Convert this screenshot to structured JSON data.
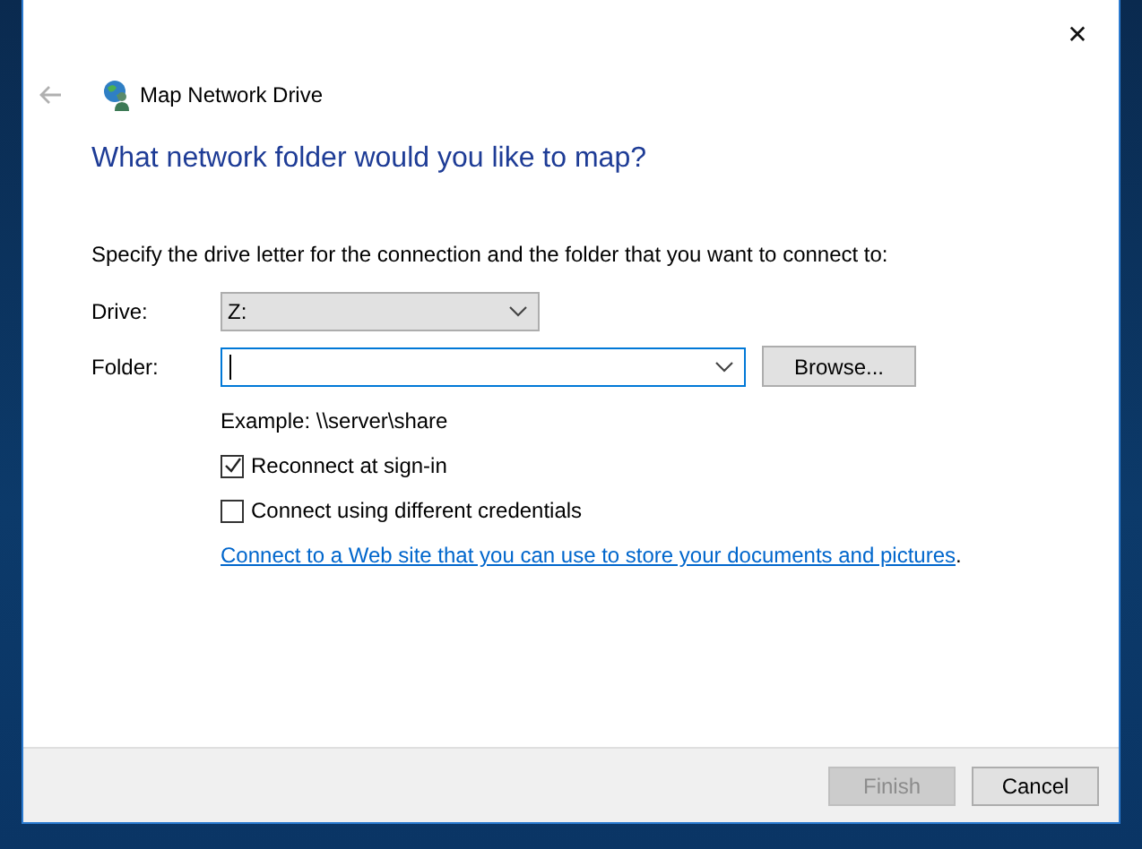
{
  "window": {
    "title": "Map Network Drive",
    "close": "✕"
  },
  "heading": "What network folder would you like to map?",
  "instruction": "Specify the drive letter for the connection and the folder that you want to connect to:",
  "drive": {
    "label": "Drive:",
    "value": "Z:"
  },
  "folder": {
    "label": "Folder:",
    "browse": "Browse..."
  },
  "example": "Example: \\\\server\\share",
  "options": [
    {
      "label": "Reconnect at sign-in",
      "checked": true
    },
    {
      "label": "Connect using different credentials",
      "checked": false
    }
  ],
  "link": {
    "text": "Connect to a Web site that you can use to store your documents and pictures",
    "suffix": "."
  },
  "buttons": [
    {
      "label": "Finish",
      "disabled": true
    },
    {
      "label": "Cancel",
      "disabled": false
    }
  ]
}
